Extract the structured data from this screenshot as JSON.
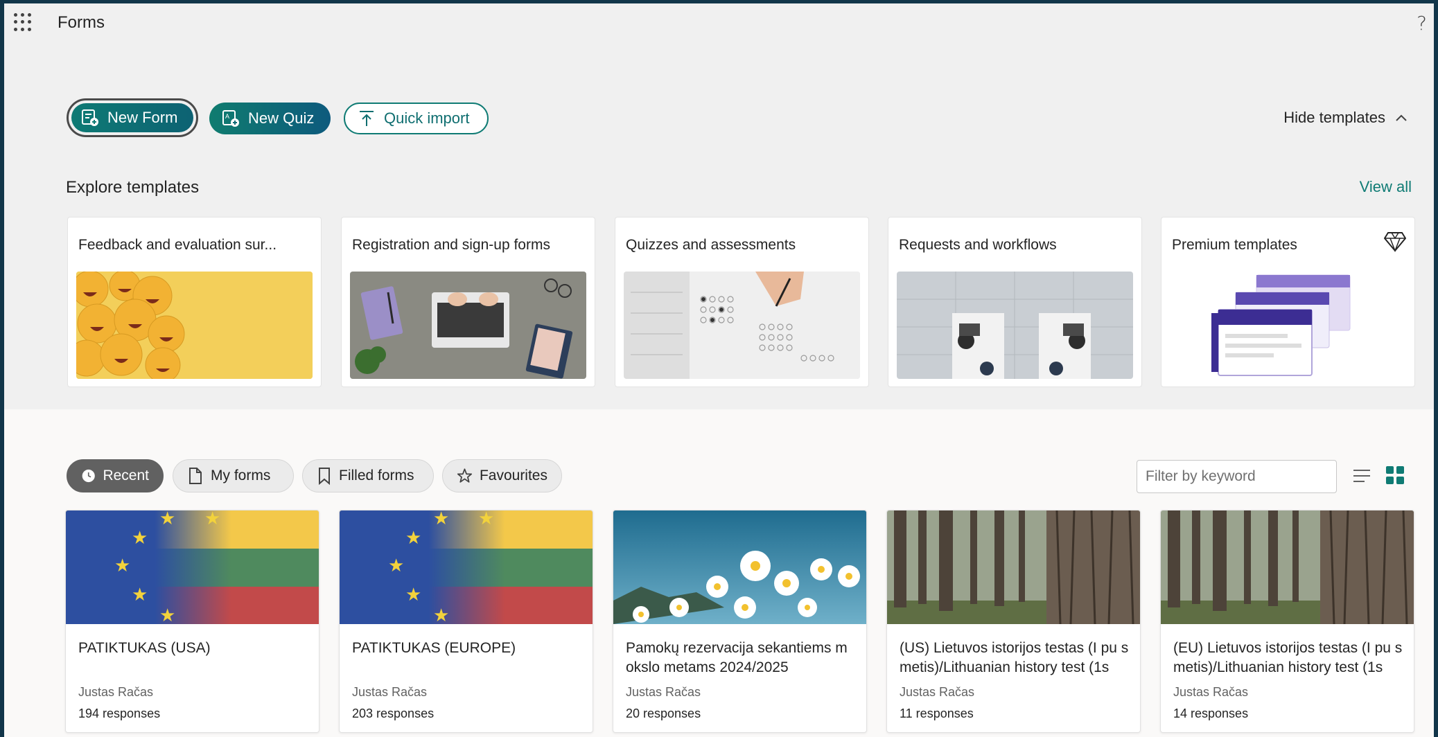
{
  "header": {
    "app_title": "Forms",
    "help_glyph": "?"
  },
  "actions": {
    "new_form": "New Form",
    "new_quiz": "New Quiz",
    "quick_import": "Quick import",
    "hide_templates": "Hide templates"
  },
  "templates": {
    "section_title": "Explore templates",
    "view_all": "View all",
    "items": [
      {
        "label": "Feedback and evaluation sur..."
      },
      {
        "label": "Registration and sign-up forms"
      },
      {
        "label": "Quizzes and assessments"
      },
      {
        "label": "Requests and workflows"
      },
      {
        "label": "Premium templates"
      }
    ]
  },
  "tabs": [
    {
      "label": "Recent",
      "icon": "clock-icon",
      "active": true
    },
    {
      "label": "My forms",
      "icon": "document-icon",
      "active": false
    },
    {
      "label": "Filled forms",
      "icon": "bookmark-icon",
      "active": false
    },
    {
      "label": "Favourites",
      "icon": "star-icon",
      "active": false
    }
  ],
  "filter": {
    "placeholder": "Filter by keyword"
  },
  "forms": [
    {
      "title": "PATIKTUKAS (USA)",
      "owner": "Justas Račas",
      "responses": "194 responses"
    },
    {
      "title": "PATIKTUKAS (EUROPE)",
      "owner": "Justas Račas",
      "responses": "203 responses"
    },
    {
      "title": "Pamokų rezervacija sekantiems m okslo metams 2024/2025",
      "owner": "Justas Račas",
      "responses": "20 responses"
    },
    {
      "title": "(US) Lietuvos istorijos testas (I pu smetis)/Lithuanian history test (1s",
      "owner": "Justas Račas",
      "responses": "11 responses"
    },
    {
      "title": "(EU) Lietuvos istorijos testas (I pu smetis)/Lithuanian history test (1s",
      "owner": "Justas Račas",
      "responses": "14 responses"
    }
  ],
  "colors": {
    "accent": "#0f7b74",
    "window_border": "#12364a",
    "active_tab": "#616161"
  }
}
